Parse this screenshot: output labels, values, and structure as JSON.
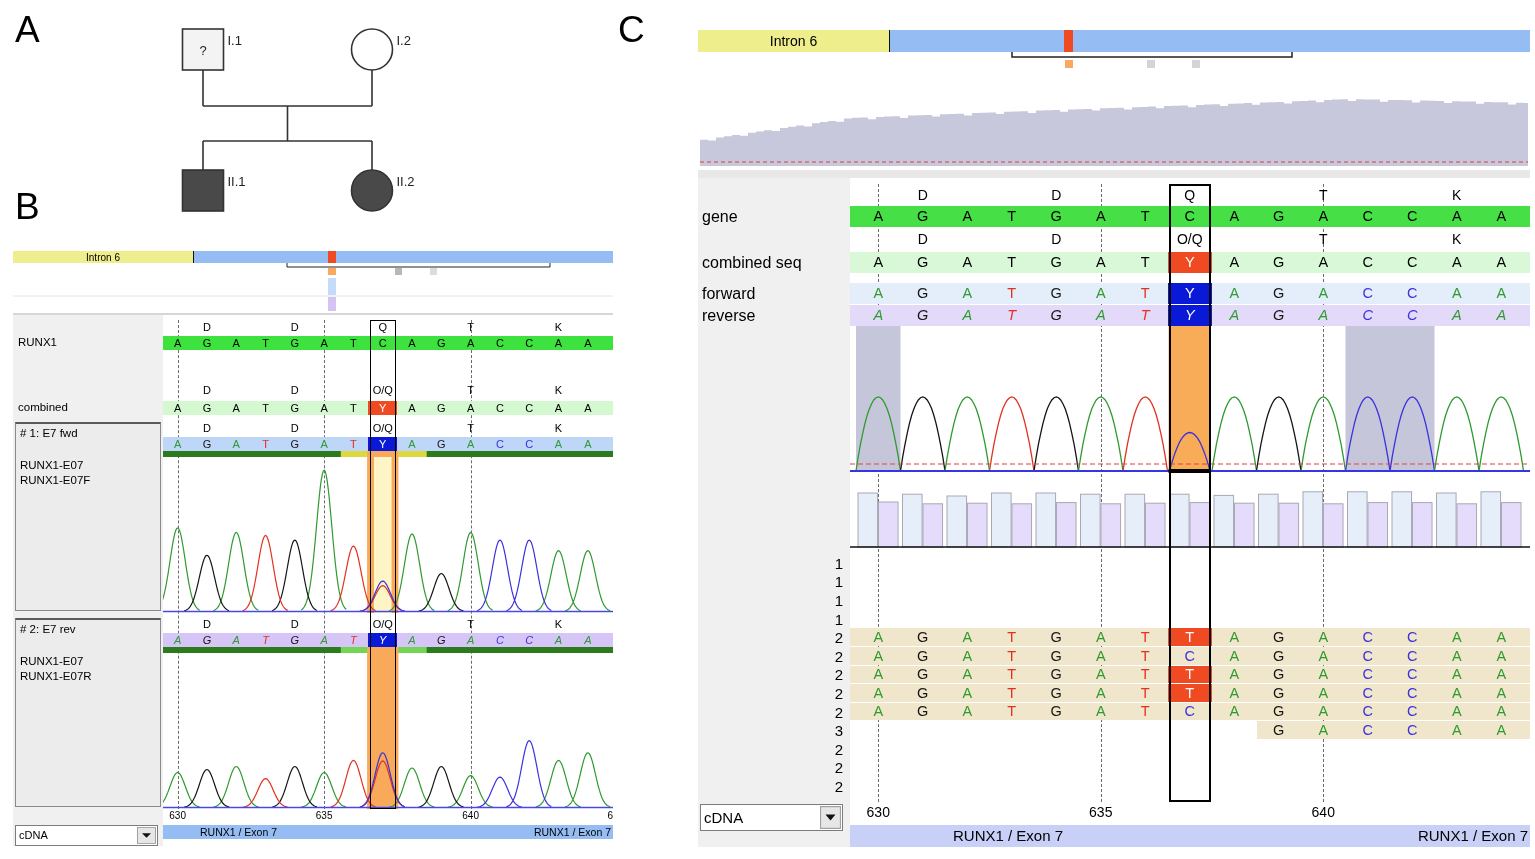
{
  "panel_a": {
    "label": "A",
    "pedigree": {
      "parents": [
        {
          "label": "I.1",
          "kind": "male",
          "affected": false,
          "mark": "?"
        },
        {
          "label": "I.2",
          "kind": "female",
          "affected": false
        }
      ],
      "offspring": [
        {
          "label": "II.1",
          "kind": "male",
          "affected": true
        },
        {
          "label": "II.2",
          "kind": "female",
          "affected": true
        }
      ]
    }
  },
  "panel_b": {
    "label": "B",
    "viewer": {
      "overview": {
        "region_label": "Intron 6"
      },
      "reference": {
        "name": "RUNX1",
        "amino_acids": [
          "D",
          "D",
          "Q",
          "T",
          "K"
        ],
        "bases": [
          "A",
          "G",
          "A",
          "T",
          "G",
          "A",
          "T",
          "C",
          "A",
          "G",
          "A",
          "C",
          "C",
          "A",
          "A"
        ]
      },
      "combined": {
        "name": "combined",
        "amino_acids": [
          "D",
          "D",
          "O/Q",
          "T",
          "K"
        ],
        "bases": [
          "A",
          "G",
          "A",
          "T",
          "G",
          "A",
          "T",
          "Y",
          "A",
          "G",
          "A",
          "C",
          "C",
          "A",
          "A"
        ]
      },
      "traces": [
        {
          "kind": "forward",
          "title": "# 1: E7 fwd",
          "details": [
            "RUNX1-E07",
            "RUNX1-E07F"
          ],
          "amino_acids": [
            "D",
            "D",
            "O/Q",
            "T",
            "K"
          ],
          "bases": [
            "A",
            "G",
            "A",
            "T",
            "G",
            "A",
            "T",
            "Y",
            "A",
            "G",
            "A",
            "C",
            "C",
            "A",
            "A"
          ]
        },
        {
          "kind": "reverse",
          "title": "# 2: E7 rev",
          "details": [
            "RUNX1-E07",
            "RUNX1-E07R"
          ],
          "amino_acids": [
            "D",
            "D",
            "O/Q",
            "T",
            "K"
          ],
          "bases": [
            "A",
            "G",
            "A",
            "T",
            "G",
            "A",
            "T",
            "Y",
            "A",
            "G",
            "A",
            "C",
            "C",
            "A",
            "A"
          ]
        }
      ],
      "axis_ticks": [
        "630",
        "635",
        "640",
        "6"
      ],
      "coordinate_mode": "cDNA",
      "exon_labels": [
        "RUNX1 / Exon 7",
        "RUNX1 / Exon 7"
      ]
    }
  },
  "panel_c": {
    "label": "C",
    "viewer": {
      "overview": {
        "region_label": "Intron 6"
      },
      "reference": {
        "name": "gene",
        "amino_acids": [
          "D",
          "D",
          "Q",
          "T",
          "K"
        ],
        "bases": [
          "A",
          "G",
          "A",
          "T",
          "G",
          "A",
          "T",
          "C",
          "A",
          "G",
          "A",
          "C",
          "C",
          "A",
          "A"
        ]
      },
      "combined": {
        "name": "combined seq",
        "amino_acids": [
          "D",
          "D",
          "O/Q",
          "T",
          "K"
        ],
        "bases": [
          "A",
          "G",
          "A",
          "T",
          "G",
          "A",
          "T",
          "Y",
          "A",
          "G",
          "A",
          "C",
          "C",
          "A",
          "A"
        ]
      },
      "strands": [
        {
          "kind": "forward",
          "name": "forward",
          "bases": [
            "A",
            "G",
            "A",
            "T",
            "G",
            "A",
            "T",
            "Y",
            "A",
            "G",
            "A",
            "C",
            "C",
            "A",
            "A"
          ]
        },
        {
          "kind": "reverse",
          "name": "reverse",
          "bases": [
            "A",
            "G",
            "A",
            "T",
            "G",
            "A",
            "T",
            "Y",
            "A",
            "G",
            "A",
            "C",
            "C",
            "A",
            "A"
          ]
        }
      ],
      "trace": {
        "shaded": [
          true,
          false,
          false,
          false,
          false,
          false,
          false,
          false,
          false,
          false,
          false,
          true,
          true,
          false,
          false
        ]
      },
      "reads": [
        {
          "label": "1"
        },
        {
          "label": "1"
        },
        {
          "label": "1"
        },
        {
          "label": "1"
        },
        {
          "label": "2",
          "bases": [
            "A",
            "G",
            "A",
            "T",
            "G",
            "A",
            "T",
            "T",
            "A",
            "G",
            "A",
            "C",
            "C",
            "A",
            "A"
          ]
        },
        {
          "label": "2",
          "bases": [
            "A",
            "G",
            "A",
            "T",
            "G",
            "A",
            "T",
            "C",
            "A",
            "G",
            "A",
            "C",
            "C",
            "A",
            "A"
          ]
        },
        {
          "label": "2",
          "bases": [
            "A",
            "G",
            "A",
            "T",
            "G",
            "A",
            "T",
            "T",
            "A",
            "G",
            "A",
            "C",
            "C",
            "A",
            "A"
          ]
        },
        {
          "label": "2",
          "bases": [
            "A",
            "G",
            "A",
            "T",
            "G",
            "A",
            "T",
            "T",
            "A",
            "G",
            "A",
            "C",
            "C",
            "A",
            "A"
          ]
        },
        {
          "label": "2",
          "bases": [
            "A",
            "G",
            "A",
            "T",
            "G",
            "A",
            "T",
            "C",
            "A",
            "G",
            "A",
            "C",
            "C",
            "A",
            "A"
          ]
        },
        {
          "label": "3",
          "bases": [
            "G",
            "A",
            "C",
            "C",
            "A",
            "A"
          ]
        },
        {
          "label": "2"
        },
        {
          "label": "2"
        },
        {
          "label": "2"
        }
      ],
      "axis_ticks": [
        "630",
        "635",
        "640"
      ],
      "coordinate_mode": "cDNA",
      "exon_labels": [
        "RUNX1 / Exon 7",
        "RUNX1 / Exon 7"
      ]
    }
  }
}
